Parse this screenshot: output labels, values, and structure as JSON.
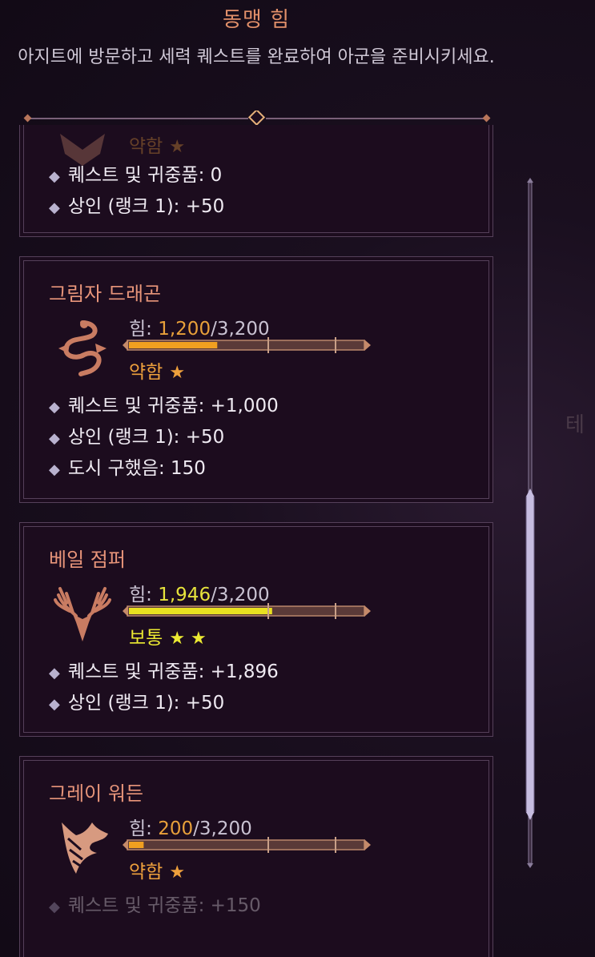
{
  "header": {
    "title": "동맹 힘",
    "description": "아지트에 방문하고 세력 퀘스트를 완료하여 아군을 준비시키세요."
  },
  "side_text": "테",
  "factions": [
    {
      "name": "",
      "rank_label": "약함",
      "stars": "★",
      "bullets": [
        "퀘스트 및 귀중품: 0",
        "상인 (랭크 1): +50"
      ]
    },
    {
      "name": "그림자 드래곤",
      "power_label": "힘:",
      "power_current": "1,200",
      "power_max": "/3,200",
      "power_fraction": 0.375,
      "rank_label": "약함",
      "stars": "★",
      "bullets": [
        "퀘스트 및 귀중품: +1,000",
        "상인 (랭크 1): +50",
        "도시 구했음: 150"
      ]
    },
    {
      "name": "베일 점퍼",
      "power_label": "힘:",
      "power_current": "1,946",
      "power_max": "/3,200",
      "power_fraction": 0.608,
      "rank_label": "보통",
      "stars": "★ ★",
      "bullets": [
        "퀘스트 및 귀중품: +1,896",
        "상인 (랭크 1): +50"
      ]
    },
    {
      "name": "그레이 워든",
      "power_label": "힘:",
      "power_current": "200",
      "power_max": "/3,200",
      "power_fraction": 0.0625,
      "rank_label": "약함",
      "stars": "★",
      "bullets": [
        "퀘스트 및 귀중품: +150"
      ]
    }
  ],
  "colors": {
    "name": "#e8957a",
    "weak": "#eea03c",
    "normal": "#ecea32",
    "card_bg": "#1c0c1e",
    "border": "#55405a"
  },
  "icons": [
    "shadow-dragon-emblem-icon",
    "veil-jumper-emblem-icon",
    "grey-warden-emblem-icon",
    "diamond-bullet-icon"
  ]
}
